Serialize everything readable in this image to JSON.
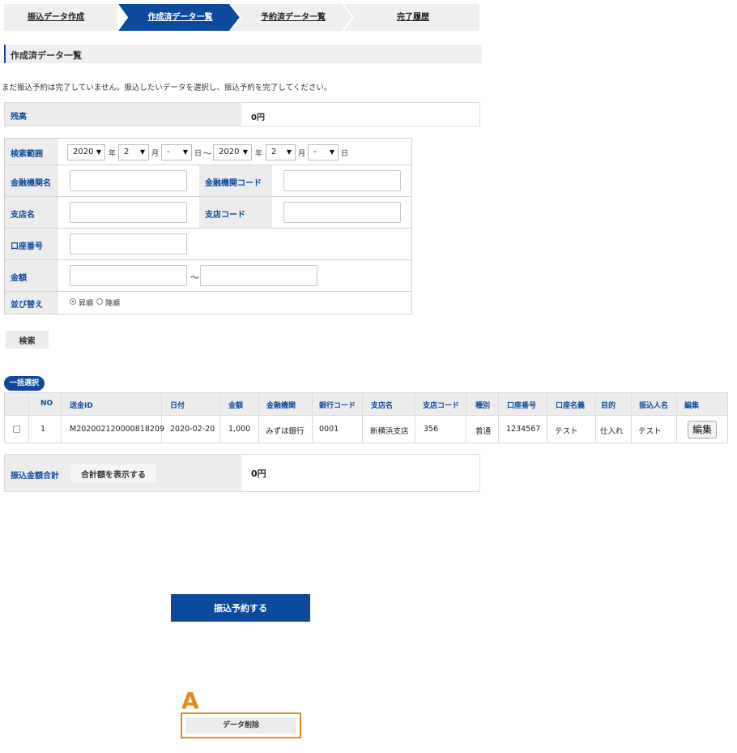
{
  "steps": [
    "振込データ作成",
    "作成済データ一覧",
    "予約済データ一覧",
    "完了履歴"
  ],
  "colors": {
    "primary": "#0d4a9b",
    "label_bg": "#ececec",
    "marker": "#e48a1c",
    "step_bg": "#efefef"
  },
  "section_title": "作成済データ一覧",
  "notice": "まだ振込予約は完了していません。振込したいデータを選択し、振込予約を完了してください。",
  "balance": {
    "label": "残高",
    "value": "0円"
  },
  "search": {
    "date_range_label": "検索範囲",
    "from": {
      "year": "2020",
      "month": "2",
      "day": "-"
    },
    "to": {
      "year": "2020",
      "month": "2",
      "day": "-"
    },
    "unit_year": "年",
    "unit_month": "月",
    "unit_day": "日",
    "tilde": "～",
    "bank_name_label": "金融機関名",
    "bank_code_label": "金融機関コード",
    "branch_name_label": "支店名",
    "branch_code_label": "支店コード",
    "account_label": "口座番号",
    "amount_label": "金額",
    "amount_tilde": "～",
    "sort_label": "並び替え",
    "sort_asc": "昇順",
    "sort_desc": "降順",
    "search_button": "検索"
  },
  "bulk_select": "一括選択",
  "table": {
    "headers": [
      "NO",
      "送金ID",
      "日付",
      "金額",
      "金融機関",
      "銀行コード",
      "支店名",
      "支店コード",
      "種別",
      "口座番号",
      "口座名義",
      "目的",
      "振込人名",
      "編集"
    ],
    "rows": [
      {
        "no": "1",
        "id": "M202002120000818209",
        "date": "2020-02-20",
        "amount": "1,000",
        "bank": "みずほ銀行",
        "bank_code": "0001",
        "branch": "新横浜支店",
        "branch_code": "356",
        "type": "普通",
        "account": "1234567",
        "holder": "テスト",
        "purpose": "仕入れ",
        "sender": "テスト",
        "edit": "編集"
      }
    ]
  },
  "total": {
    "label": "振込金額合計",
    "button": "合計額を表示する",
    "value": "0円"
  },
  "reserve_button": "振込予約する",
  "marker": "A",
  "delete_button": "データ削除"
}
